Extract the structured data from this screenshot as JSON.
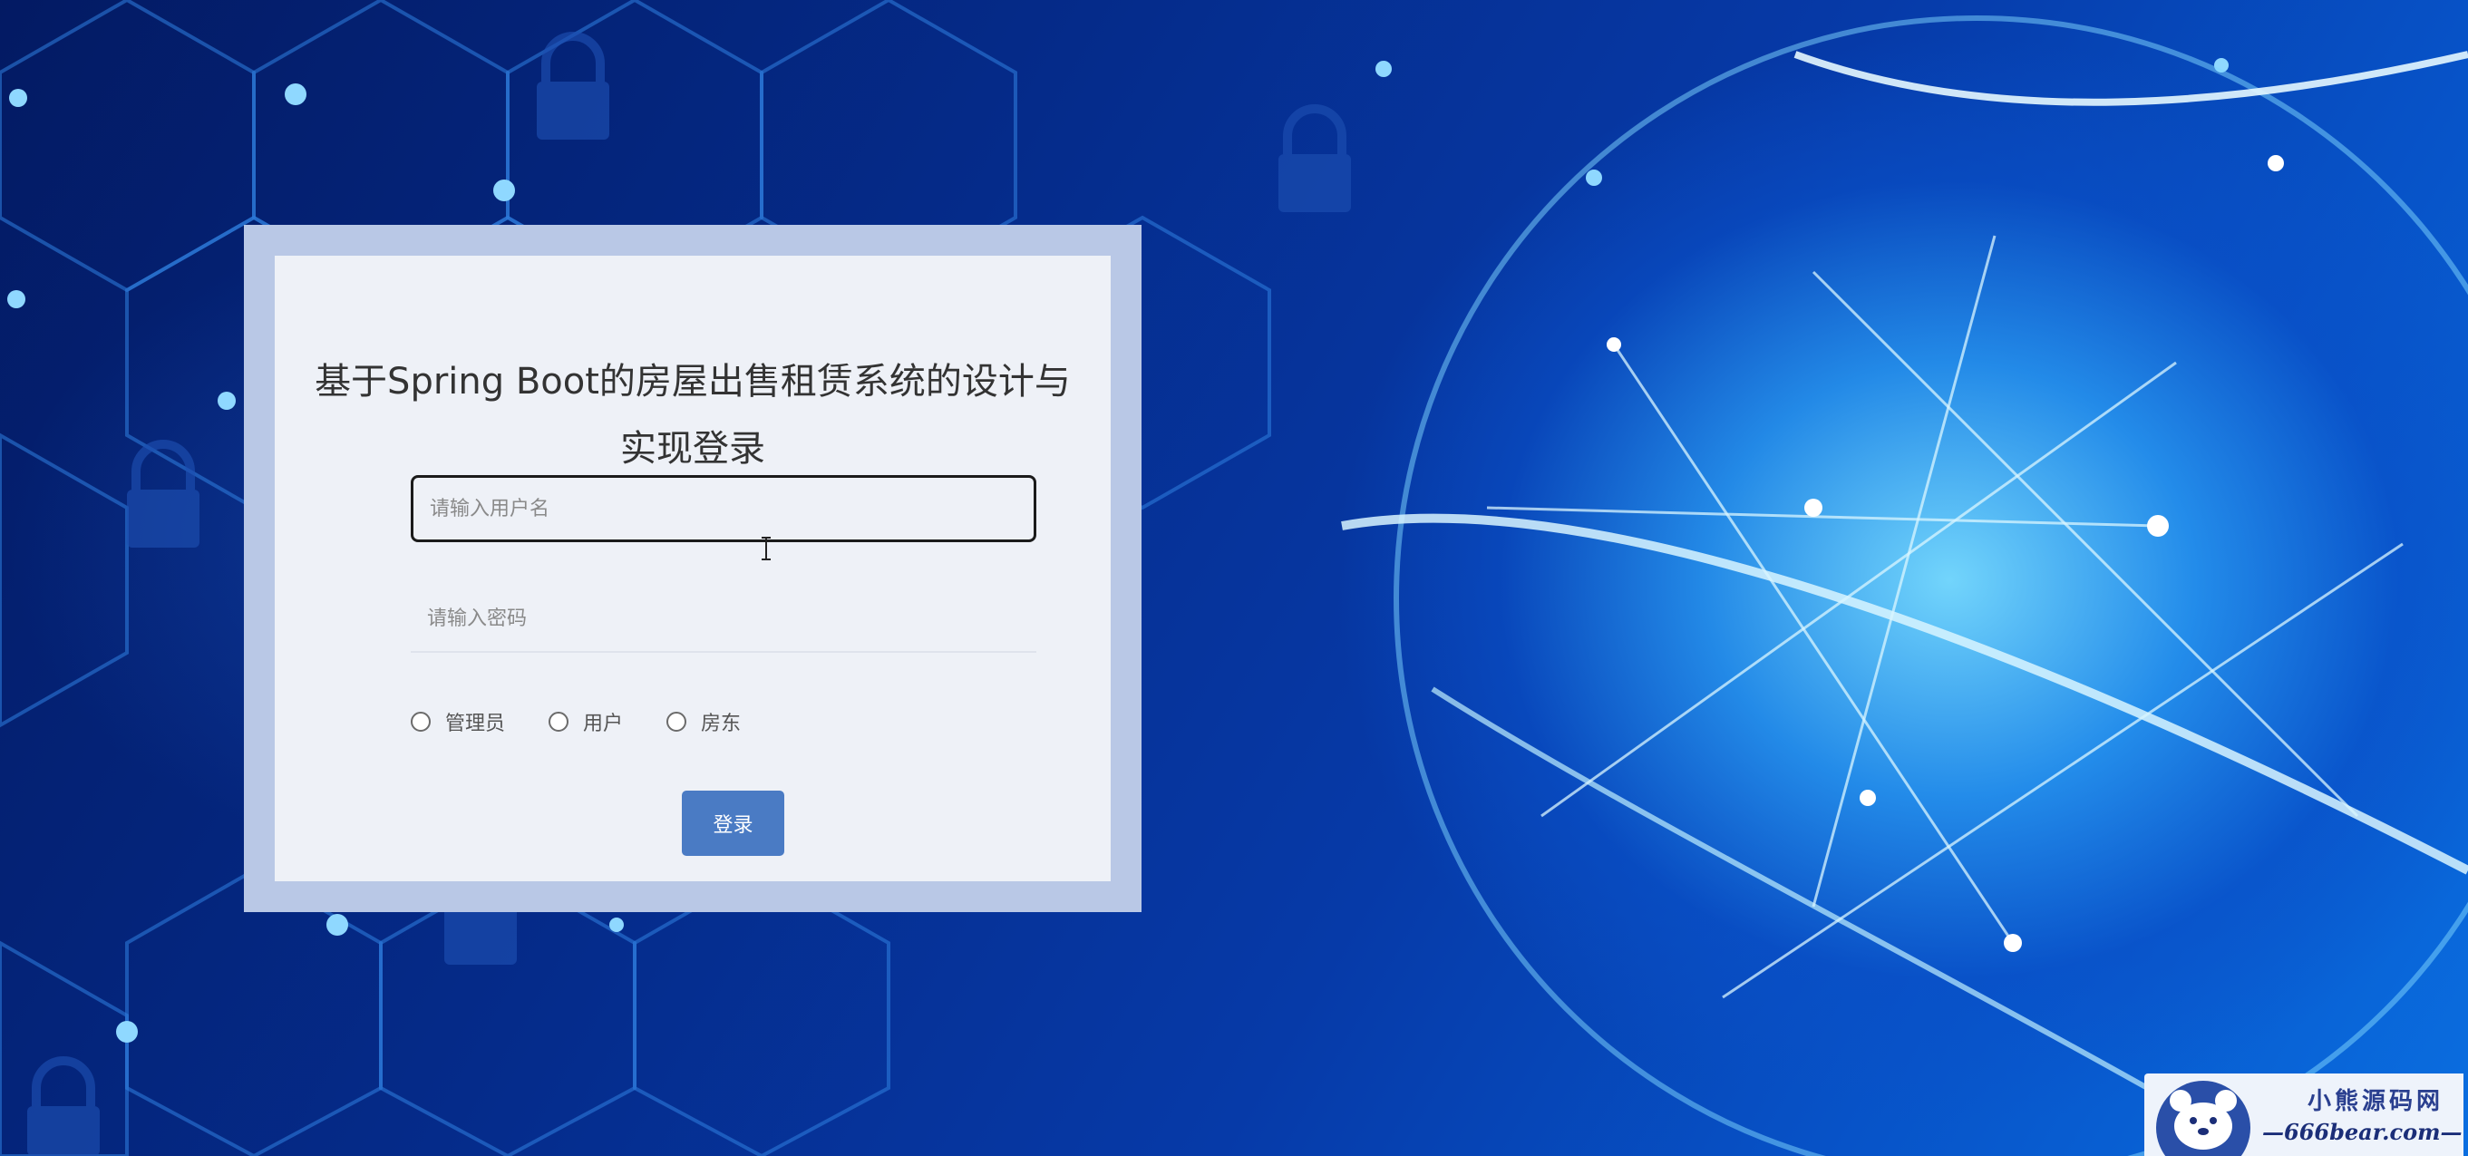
{
  "app": {
    "title": "基于Spring Boot的房屋出售租赁系统的设计与实现登录"
  },
  "login": {
    "title_line1": "基于Spring Boot的房屋出售租赁系统的设计与",
    "title_line2": "实现登录",
    "username_placeholder": "请输入用户名",
    "username_value": "",
    "password_placeholder": "请输入密码",
    "password_value": "",
    "roles": [
      {
        "label": "管理员",
        "selected": false
      },
      {
        "label": "用户",
        "selected": false
      },
      {
        "label": "房东",
        "selected": false
      }
    ],
    "submit_label": "登录"
  },
  "watermark": {
    "name": "小熊源码网",
    "url": "—666bear.com—"
  },
  "colors": {
    "button": "#4a7bc4",
    "frame": "#b9c8e6",
    "panel": "#eef1f7",
    "background": "#052b8a"
  },
  "icons": {
    "cursor": "text-cursor-icon",
    "mascot": "bear-logo-icon",
    "lock": "lock-icon"
  }
}
